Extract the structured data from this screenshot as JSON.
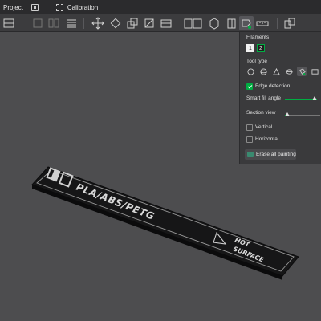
{
  "menu": {
    "project_label": "Project",
    "calibration_label": "Calibration"
  },
  "toolbar": {
    "icons": [
      "grid-icon",
      "grid-icon",
      "list-icon",
      "move-icon",
      "rotate-icon",
      "scale-icon",
      "lay-on-face-icon",
      "cut-icon",
      "support-paint-icon",
      "seam-paint-icon",
      "color-paint-icon",
      "measure-icon",
      "assembly-icon"
    ]
  },
  "panel": {
    "filaments_label": "Filaments",
    "filaments": [
      {
        "label": "1",
        "color": "#f2f2f2"
      },
      {
        "label": "2",
        "color": "#1f1f1f"
      }
    ],
    "selected_filament": "2",
    "tool_type_label": "Tool type",
    "edge_detection_label": "Edge detection",
    "edge_detection_checked": true,
    "smart_fill_label": "Smart fill angle",
    "section_view_label": "Section view",
    "vertical_label": "Vertical",
    "vertical_checked": false,
    "horizontal_label": "Horizontal",
    "horizontal_checked": false,
    "erase_label": "Erase all painting"
  },
  "model": {
    "text_main": "PLA/ABS/PETG",
    "text_hot": "HOT",
    "text_surface": "SURFACE",
    "accent_color": "#00ae42"
  }
}
